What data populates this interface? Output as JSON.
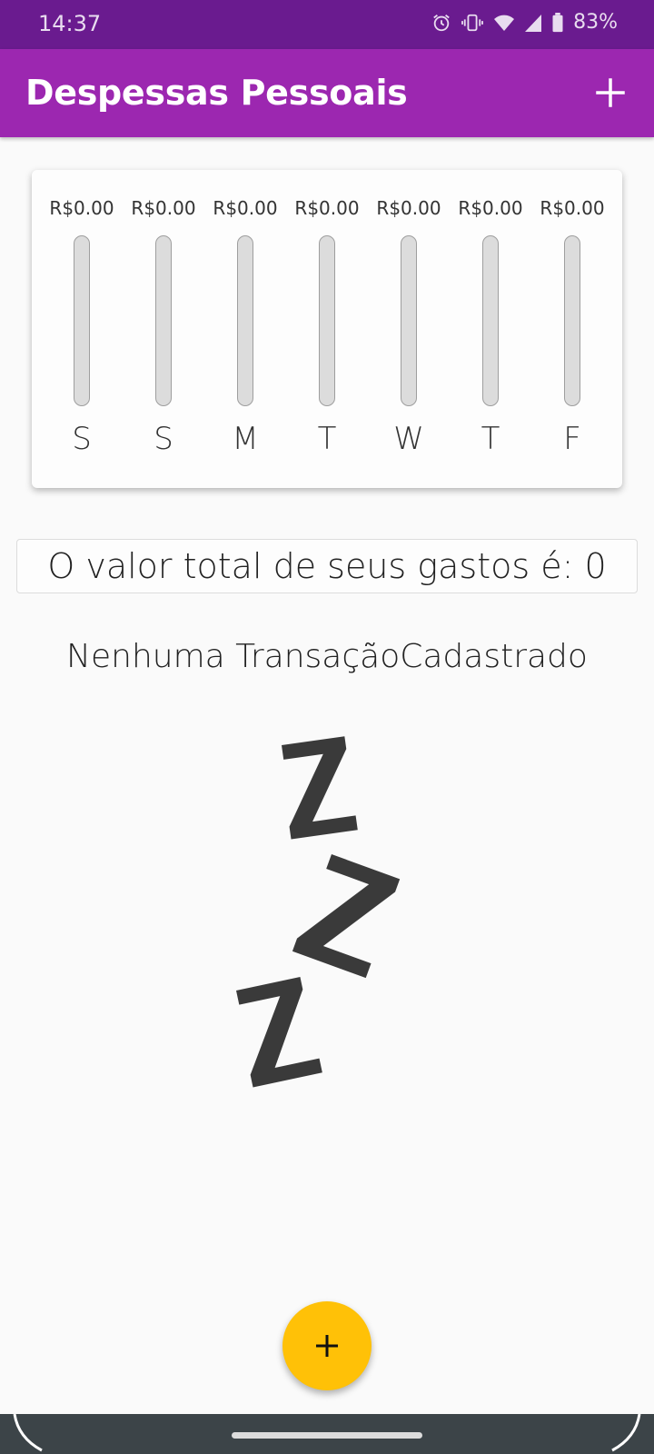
{
  "status_bar": {
    "time": "14:37",
    "battery": "83%",
    "icons": [
      "alarm-icon",
      "vibrate-icon",
      "wifi-icon",
      "signal-icon",
      "battery-icon"
    ]
  },
  "app_bar": {
    "title": "Despessas Pessoais",
    "add_icon": "plus-icon",
    "color": "#9c27b0"
  },
  "chart_data": {
    "type": "bar",
    "categories": [
      "S",
      "S",
      "M",
      "T",
      "W",
      "T",
      "F"
    ],
    "value_labels": [
      "R$0.00",
      "R$0.00",
      "R$0.00",
      "R$0.00",
      "R$0.00",
      "R$0.00",
      "R$0.00"
    ],
    "values": [
      0,
      0,
      0,
      0,
      0,
      0,
      0
    ],
    "fill_fractions": [
      0,
      0,
      0,
      0,
      0,
      0,
      0
    ]
  },
  "total": {
    "text": "O valor total de seus gastos é: 0"
  },
  "empty_state": {
    "text": "Nenhuma TransaçãoCadastrado",
    "image_icon": "zzz-sleep-icon"
  },
  "fab": {
    "icon": "plus-icon",
    "color": "#ffc107"
  }
}
